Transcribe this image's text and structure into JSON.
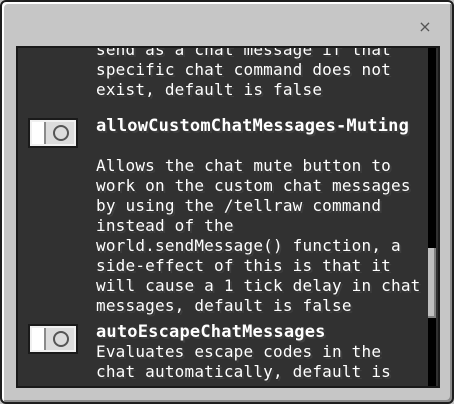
{
  "dialog": {
    "close_label": "×"
  },
  "scrolled_fragment": {
    "text": "send as a chat message if that specific chat command does not exist, default is false"
  },
  "options": [
    {
      "title": "allowCustomChatMessages-Muting",
      "description": "Allows the chat mute button to work on the custom chat messages by using the /tellraw command instead of the world.sendMessage() function, a side-effect of this is that it will cause a 1 tick delay in chat messages, default is false",
      "enabled": false
    },
    {
      "title": "autoEscapeChatMessages",
      "description": "Evaluates escape codes in the chat automatically, default is",
      "enabled": false
    }
  ],
  "colors": {
    "panel_bg": "#313131",
    "dialog_bg": "#c6c6c6",
    "text": "#ffffff"
  }
}
